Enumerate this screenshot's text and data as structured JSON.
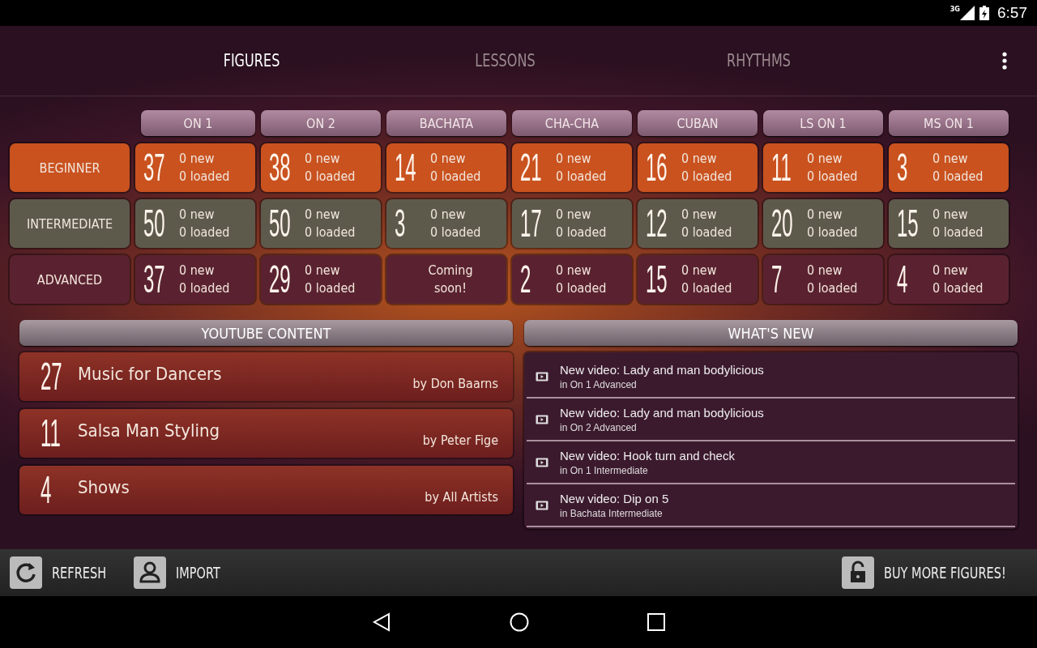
{
  "status_bar": {
    "network": "3G",
    "time": "6:57"
  },
  "tabs": [
    {
      "label": "FIGURES",
      "selected": true
    },
    {
      "label": "LESSONS",
      "selected": false
    },
    {
      "label": "RHYTHMS",
      "selected": false
    }
  ],
  "grid": {
    "columns": [
      "ON 1",
      "ON 2",
      "BACHATA",
      "CHA-CHA",
      "CUBAN",
      "LS ON 1",
      "MS ON 1"
    ],
    "rows": [
      {
        "label": "BEGINNER",
        "color": "#c9521f",
        "cells": [
          {
            "kind": "count",
            "count": "37",
            "new": "0 new",
            "loaded": "0 loaded"
          },
          {
            "kind": "count",
            "count": "38",
            "new": "0 new",
            "loaded": "0 loaded"
          },
          {
            "kind": "count",
            "count": "14",
            "new": "0 new",
            "loaded": "0 loaded"
          },
          {
            "kind": "count",
            "count": "21",
            "new": "0 new",
            "loaded": "0 loaded"
          },
          {
            "kind": "count",
            "count": "16",
            "new": "0 new",
            "loaded": "0 loaded"
          },
          {
            "kind": "count",
            "count": "11",
            "new": "0 new",
            "loaded": "0 loaded"
          },
          {
            "kind": "count",
            "count": "3",
            "new": "0 new",
            "loaded": "0 loaded"
          }
        ]
      },
      {
        "label": "INTERMEDIATE",
        "color": "#5d5a4c",
        "cells": [
          {
            "kind": "count",
            "count": "50",
            "new": "0 new",
            "loaded": "0 loaded"
          },
          {
            "kind": "count",
            "count": "50",
            "new": "0 new",
            "loaded": "0 loaded"
          },
          {
            "kind": "count",
            "count": "3",
            "new": "0 new",
            "loaded": "0 loaded"
          },
          {
            "kind": "count",
            "count": "17",
            "new": "0 new",
            "loaded": "0 loaded"
          },
          {
            "kind": "count",
            "count": "12",
            "new": "0 new",
            "loaded": "0 loaded"
          },
          {
            "kind": "count",
            "count": "20",
            "new": "0 new",
            "loaded": "0 loaded"
          },
          {
            "kind": "count",
            "count": "15",
            "new": "0 new",
            "loaded": "0 loaded"
          }
        ]
      },
      {
        "label": "ADVANCED",
        "color": "#5a2230",
        "cells": [
          {
            "kind": "count",
            "count": "37",
            "new": "0 new",
            "loaded": "0 loaded"
          },
          {
            "kind": "count",
            "count": "29",
            "new": "0 new",
            "loaded": "0 loaded"
          },
          {
            "kind": "coming_soon",
            "text": "Coming soon!"
          },
          {
            "kind": "count",
            "count": "2",
            "new": "0 new",
            "loaded": "0 loaded"
          },
          {
            "kind": "count",
            "count": "15",
            "new": "0 new",
            "loaded": "0 loaded"
          },
          {
            "kind": "count",
            "count": "7",
            "new": "0 new",
            "loaded": "0 loaded"
          },
          {
            "kind": "count",
            "count": "4",
            "new": "0 new",
            "loaded": "0 loaded"
          }
        ]
      }
    ]
  },
  "youtube": {
    "title": "YOUTUBE CONTENT",
    "items": [
      {
        "count": "27",
        "title": "Music for Dancers",
        "author": "by Don Baarns"
      },
      {
        "count": "11",
        "title": "Salsa Man Styling",
        "author": "by Peter Fige"
      },
      {
        "count": "4",
        "title": "Shows",
        "author": "by All Artists"
      }
    ]
  },
  "whats_new": {
    "title": "WHAT'S NEW",
    "items": [
      {
        "title": "New video: Lady and man bodylicious",
        "subtitle": "in On 1 Advanced"
      },
      {
        "title": "New video: Lady and man bodylicious",
        "subtitle": "in On 2 Advanced"
      },
      {
        "title": "New video: Hook turn and check",
        "subtitle": "in On 1 Intermediate"
      },
      {
        "title": "New video: Dip on 5",
        "subtitle": "in Bachata Intermediate"
      }
    ]
  },
  "actions": {
    "refresh": "REFRESH",
    "import": "IMPORT",
    "buy": "BUY MORE FIGURES!"
  }
}
